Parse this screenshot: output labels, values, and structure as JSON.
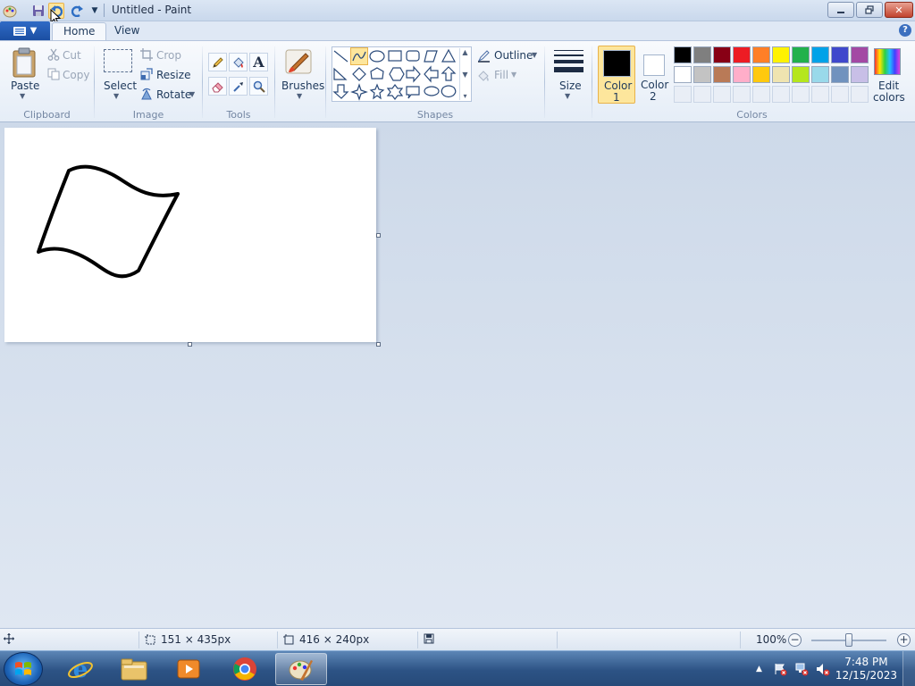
{
  "window": {
    "title": "Untitled - Paint"
  },
  "tabs": {
    "home": "Home",
    "view": "View"
  },
  "ribbon": {
    "clipboard": {
      "paste": "Paste",
      "cut": "Cut",
      "copy": "Copy",
      "label": "Clipboard"
    },
    "image": {
      "select": "Select",
      "crop": "Crop",
      "resize": "Resize",
      "rotate": "Rotate",
      "label": "Image"
    },
    "tools": {
      "label": "Tools"
    },
    "brushes": {
      "label": "Brushes"
    },
    "shapes": {
      "outline": "Outline",
      "fill": "Fill",
      "label": "Shapes"
    },
    "size": {
      "label": "Size"
    },
    "colors": {
      "color1_line1": "Color",
      "color1_line2": "1",
      "color2_line1": "Color",
      "color2_line2": "2",
      "edit_line1": "Edit",
      "edit_line2": "colors",
      "label": "Colors",
      "color1": "#000000",
      "color2": "#ffffff",
      "palette_row1": [
        "#000000",
        "#7f7f7f",
        "#880015",
        "#ed1c24",
        "#ff7f27",
        "#fff200",
        "#22b14c",
        "#00a2e8",
        "#3f48cc",
        "#a349a4"
      ],
      "palette_row2": [
        "#ffffff",
        "#c3c3c3",
        "#b97a57",
        "#ffaec9",
        "#ffc90e",
        "#efe4b0",
        "#b5e61d",
        "#99d9ea",
        "#7092be",
        "#c8bfe7"
      ]
    }
  },
  "status": {
    "cursor_pos": "151 × 435px",
    "canvas_size": "416 × 240px",
    "zoom": "100%"
  },
  "taskbar": {
    "clock_time": "7:48 PM",
    "clock_date": "12/15/2023"
  }
}
